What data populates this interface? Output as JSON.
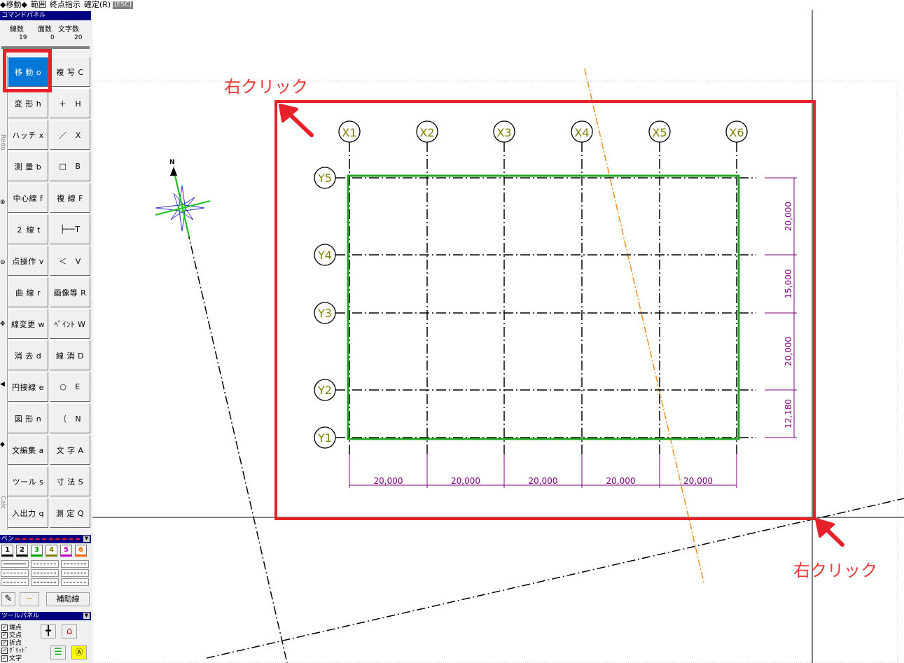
{
  "menubar": {
    "items": [
      "◆移動◆",
      "範囲",
      "終点指示",
      "確定(R)"
    ],
    "esc": "[ESC]"
  },
  "command_panel": {
    "title": "コマンドパネル",
    "counts": [
      {
        "label": "線数",
        "value": "19"
      },
      {
        "label": "面数",
        "value": "0"
      },
      {
        "label": "文字数",
        "value": "20"
      }
    ],
    "buttons": [
      {
        "label": "移 動 o",
        "active": true
      },
      {
        "label": "複 写 C"
      },
      {
        "label": "変 形 h"
      },
      {
        "label": "＋   H"
      },
      {
        "label": "ハッチ x"
      },
      {
        "label": "／   X"
      },
      {
        "label": "測 量 b"
      },
      {
        "label": "□   B"
      },
      {
        "label": "中心線 f"
      },
      {
        "label": "複 線 F"
      },
      {
        "label": "２ 線 t"
      },
      {
        "label": "├──T"
      },
      {
        "label": "点操作 v"
      },
      {
        "label": "＜   V"
      },
      {
        "label": "曲 線 r"
      },
      {
        "label": "画像等 R"
      },
      {
        "label": "線変更 w"
      },
      {
        "label": "ﾍﾟｲﾝﾄ W"
      },
      {
        "label": "消 去 d"
      },
      {
        "label": "線 消 D"
      },
      {
        "label": "円接線 e"
      },
      {
        "label": "○   E"
      },
      {
        "label": "図 形 n"
      },
      {
        "label": "（   N"
      },
      {
        "label": "文編集 a"
      },
      {
        "label": "文 字 A"
      },
      {
        "label": "ツール s"
      },
      {
        "label": "寸 法 S"
      },
      {
        "label": "入出力 q"
      },
      {
        "label": "測 定 Q"
      }
    ],
    "side_strip": [
      "Redo",
      "Calc"
    ]
  },
  "pen_panel": {
    "title": "ペン",
    "pens": [
      {
        "num": "1",
        "color": "#000000"
      },
      {
        "num": "2",
        "color": "#000000"
      },
      {
        "num": "3",
        "color": "#00a000"
      },
      {
        "num": "4",
        "color": "#808000"
      },
      {
        "num": "5",
        "color": "#c000c0"
      },
      {
        "num": "6",
        "color": "#ff6000"
      }
    ],
    "aux_line": "補助線"
  },
  "tool_panel": {
    "title": "ツールパネル",
    "snaps": [
      "端点",
      "交点",
      "折点",
      "ｸﾞﾘｯﾄﾞ",
      "文字"
    ]
  },
  "drawing": {
    "x_labels": [
      "X1",
      "X2",
      "X3",
      "X4",
      "X5",
      "X6"
    ],
    "y_labels": [
      "Y5",
      "Y4",
      "Y3",
      "Y2",
      "Y1"
    ],
    "x_dims": [
      "20,000",
      "20,000",
      "20,000",
      "20,000",
      "20,000"
    ],
    "y_dims": [
      "20,000",
      "15,000",
      "20,000",
      "12,180"
    ],
    "north": "N",
    "colors": {
      "selection_frame": "#e8202a",
      "green_rect": "#22a822",
      "orange_line": "#f0901c",
      "dimension": "#800080",
      "grid_label": "#808000"
    }
  },
  "annotations": {
    "top": "右クリック",
    "bottom": "右クリック"
  }
}
